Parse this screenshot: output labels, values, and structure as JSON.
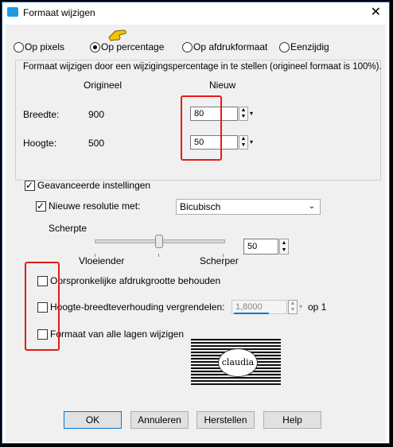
{
  "window": {
    "title": "Formaat wijzigen",
    "close_glyph": "✕"
  },
  "mode_radios": [
    {
      "label": "Op pixels",
      "selected": false
    },
    {
      "label": "Op percentage",
      "selected": true
    },
    {
      "label": "Op afdrukformaat",
      "selected": false
    },
    {
      "label": "Eenzijdig",
      "selected": false
    }
  ],
  "info_text": "Formaat wijzigen door een wijzigingspercentage in te stellen (origineel formaat  is 100%).",
  "columns": {
    "original": "Origineel",
    "new": "Nieuw"
  },
  "width": {
    "label": "Breedte:",
    "original": "900",
    "new": "80"
  },
  "height": {
    "label": "Hoogte:",
    "original": "500",
    "new": "50"
  },
  "advanced": {
    "label": "Geavanceerde instellingen",
    "checked": true
  },
  "resolution": {
    "label": "Nieuwe resolutie met:",
    "checked": true,
    "method": "Bicubisch"
  },
  "sharpness": {
    "label": "Scherpte",
    "left_label": "Vloeiender",
    "right_label": "Scherper",
    "value": "50",
    "level": 0.5
  },
  "options": [
    {
      "label": "Oorspronkelijke afdrukgrootte behouden",
      "checked": false
    },
    {
      "label": "Hoogte-breedteverhouding vergrendelen:",
      "checked": false
    },
    {
      "label": "Formaat van alle lagen wijzigen",
      "checked": false
    }
  ],
  "ratio": {
    "value": "1,8000",
    "suffix": "op 1"
  },
  "preview": {
    "logo_text": "claudia"
  },
  "buttons": {
    "ok": "OK",
    "cancel": "Annuleren",
    "reset": "Herstellen",
    "help": "Help"
  },
  "colors": {
    "highlight": "#e51a1a",
    "accent": "#0078d7",
    "pointer": "#f5c400"
  }
}
